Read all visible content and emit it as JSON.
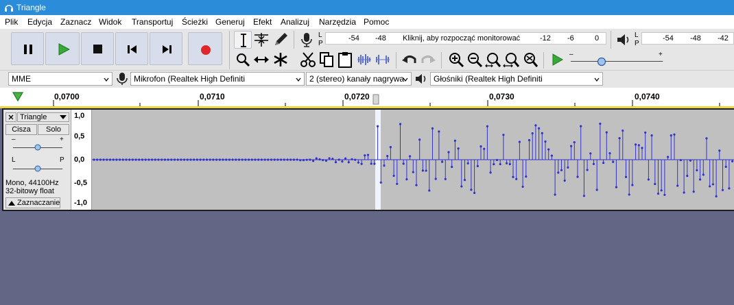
{
  "window": {
    "title": "Triangle"
  },
  "menu": [
    "Plik",
    "Edycja",
    "Zaznacz",
    "Widok",
    "Transportuj",
    "Ścieżki",
    "Generuj",
    "Efekt",
    "Analizuj",
    "Narzędzia",
    "Pomoc"
  ],
  "meters": {
    "record_ticks": [
      "-54",
      "-48",
      "-12",
      "-6",
      "0"
    ],
    "record_hint": "Kliknij, aby rozpocząć monitorować",
    "play_ticks": [
      "-54",
      "-48",
      "-42"
    ],
    "l": "L",
    "p": "P"
  },
  "playback_speed": {
    "minus": "–",
    "plus": "+"
  },
  "devices": {
    "host": "MME",
    "mic": "Mikrofon (Realtek High Definiti",
    "channels": "2 (stereo) kanały nagrywa",
    "speaker": "Głośniki (Realtek High Definiti"
  },
  "ruler": {
    "labels": [
      "0,0700",
      "0,0710",
      "0,0720",
      "0,0730",
      "0,0740"
    ]
  },
  "track": {
    "name": "Triangle",
    "mute": "Cisza",
    "solo": "Solo",
    "gain_minus": "–",
    "gain_plus": "+",
    "pan_l": "L",
    "pan_p": "P",
    "info_rate": "Mono, 44100Hz",
    "info_format": "32-bitowy float",
    "select": "Zaznaczanie",
    "y_labels": [
      "1,0",
      "0,5",
      "0,0",
      "-0,5",
      "-1,0"
    ],
    "colors": {
      "wave": "#3232c8",
      "bg": "#c0c0c0",
      "cursor": "#f0f4ff"
    }
  }
}
